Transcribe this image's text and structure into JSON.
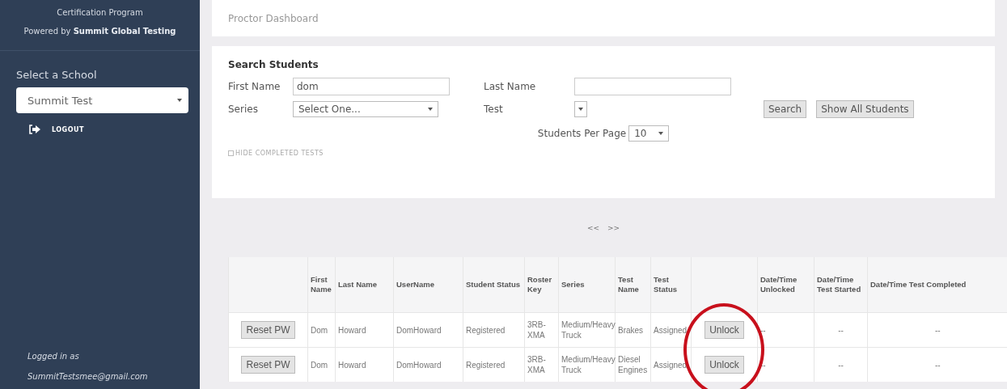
{
  "sidebar": {
    "program": "Certification Program",
    "powered_by": "Powered by **Summit Global Testing**",
    "school_label": "Select a School",
    "school_select": {
      "value": "Summit Test"
    },
    "logout": "LOGOUT",
    "logged_in_label": "Logged in as",
    "email": "SummitTestsmee@gmail.com"
  },
  "header": {
    "title": "Proctor Dashboard"
  },
  "search": {
    "title": "Search Students",
    "first_name": {
      "label": "First Name",
      "value": "dom"
    },
    "last_name": {
      "label": "Last Name"
    },
    "series": {
      "label": "Series",
      "value": "Select One..."
    },
    "test": {
      "label": "Test"
    },
    "buttons": [
      "Search",
      "Show All Students"
    ],
    "per_page": {
      "label": "Students Per Page",
      "value": "10"
    },
    "hide_completed": {
      "label": "HIDE COMPLETED TESTS",
      "checked": false
    }
  },
  "pager": {
    "prev": "<<",
    "next": ">>"
  },
  "table": {
    "columns": [
      "",
      "First Name",
      "Last Name",
      "UserName",
      "Student Status",
      "Roster Key",
      "Series",
      "Test Name",
      "Test Status",
      "",
      "Date/Time Unlocked",
      "Date/Time Test Started",
      "Date/Time Test Completed"
    ],
    "rows": [
      {
        "reset": "Reset PW",
        "first": "Dom",
        "last": "Howard",
        "username": "DomHoward",
        "status": "Registered",
        "roster": "3RB-XMA",
        "series": "Medium/Heavy Truck",
        "test_name": "Brakes",
        "test_status": "Assigned",
        "unlock": "Unlock",
        "unlocked": "--",
        "started": "--",
        "completed": "--"
      },
      {
        "reset": "Reset PW",
        "first": "Dom",
        "last": "Howard",
        "username": "DomHoward",
        "status": "Registered",
        "roster": "3RB-XMA",
        "series": "Medium/Heavy Truck",
        "test_name": "Diesel Engines",
        "test_status": "Assigned",
        "unlock": "Unlock",
        "unlocked": "--",
        "started": "--",
        "completed": "--"
      }
    ]
  }
}
